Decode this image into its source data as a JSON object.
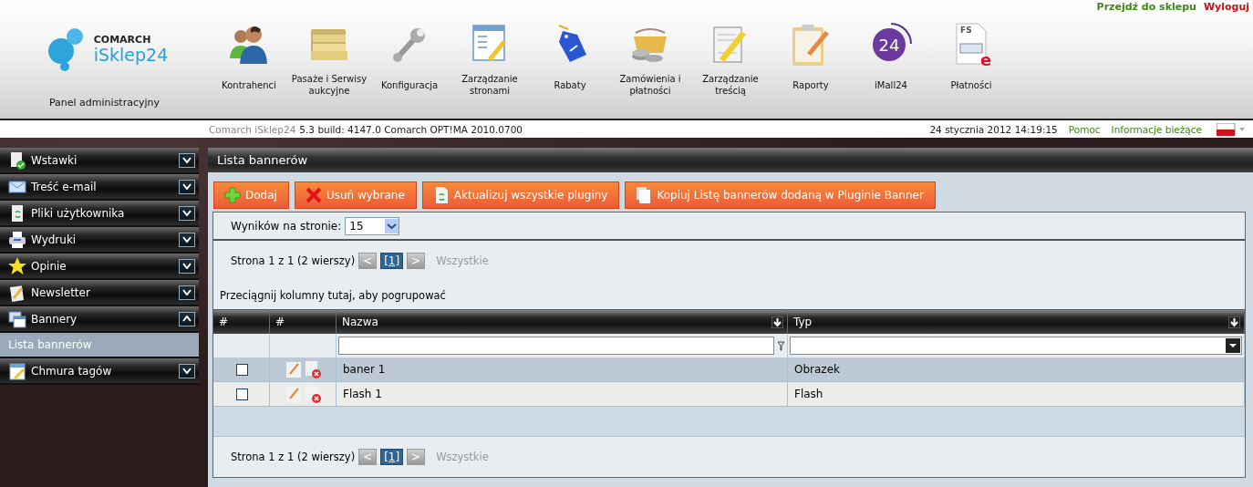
{
  "top_links": [
    {
      "label": "Przejdź do sklepu",
      "kind": "shop"
    },
    {
      "label": "Wyloguj",
      "kind": "logout"
    }
  ],
  "logo": {
    "brand": "COMARCH",
    "product": "iSklep24",
    "caption": "Panel administracyjny"
  },
  "nav": [
    {
      "label": "Kontrahenci"
    },
    {
      "label": "Pasaże i Serwisy aukcyjne"
    },
    {
      "label": "Konfiguracja"
    },
    {
      "label": "Zarządzanie stronami"
    },
    {
      "label": "Rabaty"
    },
    {
      "label": "Zamówienia i płatności"
    },
    {
      "label": "Zarządzanie treścią"
    },
    {
      "label": "Raporty"
    },
    {
      "label": "iMall24",
      "badge": "24"
    },
    {
      "label": "Płatności",
      "doc_code": "FS",
      "doc_mark": "e"
    }
  ],
  "status_bar": {
    "product": "Comarch iSklep24",
    "version": "5.3 build: 4147.0  Comarch OPT!MA 2010.0700",
    "datetime": "24 stycznia 2012 14:19:15",
    "links": [
      "Pomoc",
      "Informacje bieżące"
    ]
  },
  "sidebar": {
    "items": [
      {
        "label": "Wstawki",
        "expanded": false
      },
      {
        "label": "Treść e-mail",
        "expanded": false
      },
      {
        "label": "Pliki użytkownika",
        "expanded": false
      },
      {
        "label": "Wydruki",
        "expanded": false
      },
      {
        "label": "Opinie",
        "expanded": false
      },
      {
        "label": "Newsletter",
        "expanded": false
      },
      {
        "label": "Bannery",
        "expanded": true,
        "children": [
          {
            "label": "Lista bannerów",
            "selected": true
          }
        ]
      },
      {
        "label": "Chmura tagów",
        "expanded": false
      }
    ]
  },
  "panel": {
    "title": "Lista bannerów",
    "toolbar": [
      {
        "label": "Dodaj",
        "kind": "add"
      },
      {
        "label": "Usuń wybrane",
        "kind": "delete"
      },
      {
        "label": "Aktualizuj wszystkie pluginy",
        "kind": "refresh"
      },
      {
        "label": "Kopiuj Listę bannerów dodaną w Pluginie Banner",
        "kind": "copy"
      }
    ],
    "page_size": {
      "label": "Wyników na stronie:",
      "value": "15"
    },
    "pager_top": {
      "summary": "Strona 1 z 1 (2 wierszy)",
      "prev": "<",
      "page": "[1]",
      "next": ">",
      "all": "Wszystkie"
    },
    "group_hint": "Przeciągnij kolumny tutaj, aby pogrupować",
    "table": {
      "columns": [
        {
          "label": "#",
          "kind": "check"
        },
        {
          "label": "#",
          "kind": "actions"
        },
        {
          "label": "Nazwa",
          "kind": "text"
        },
        {
          "label": "Typ",
          "kind": "select"
        }
      ],
      "rows": [
        {
          "checked": false,
          "selected": true,
          "name": "baner 1",
          "type": "Obrazek"
        },
        {
          "checked": false,
          "selected": false,
          "name": "Flash 1",
          "type": "Flash"
        }
      ]
    },
    "pager_bottom": {
      "summary": "Strona 1 z 1 (2 wierszy)",
      "prev": "<",
      "page": "[1]",
      "next": ">",
      "all": "Wszystkie"
    }
  }
}
